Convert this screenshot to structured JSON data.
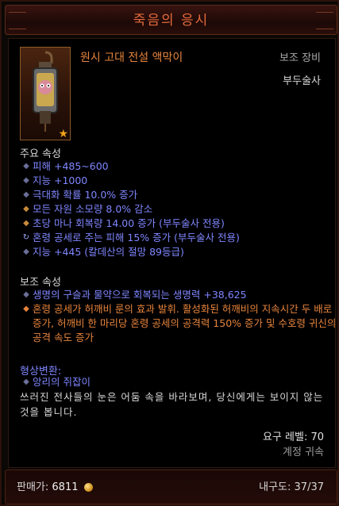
{
  "title": "죽음의 응시",
  "item": {
    "name": "원시 고대 전설 액막이",
    "type": "보조 장비",
    "class": "부두술사"
  },
  "primary": {
    "heading": "주요 속성",
    "stats": [
      {
        "text": "피해 +485~600",
        "color": "blue",
        "bullet": "diamond"
      },
      {
        "text": "지능 +1000",
        "color": "blue",
        "bullet": "diamond"
      },
      {
        "text": "극대화 확률 10.0% 증가",
        "color": "blue",
        "bullet": "diamond"
      },
      {
        "text": "모든 자원 소모량 8.0% 감소",
        "color": "blue",
        "bullet": "diamond-orange"
      },
      {
        "text": "초당 마나 회복량 14.00 증가 (부두술사 전용)",
        "color": "blue",
        "bullet": "diamond-orange"
      },
      {
        "text": "혼령 공세로 주는 피해 15% 증가 (부두술사 전용)",
        "color": "blue",
        "bullet": "reroll"
      },
      {
        "text": "지능 +445 (칼데산의 절망 89등급)",
        "color": "blue",
        "bullet": "diamond"
      }
    ]
  },
  "secondary": {
    "heading": "보조 속성",
    "stats": [
      {
        "text": "생명의 구슬과 물약으로 회복되는 생명력 +38,625",
        "color": "blue",
        "bullet": "diamond"
      }
    ],
    "legendary": "혼령 공세가 허깨비 룬의 효과 발휘. 활성화된 허깨비의 지속시간 두 배로 증가, 허깨비 한 마리당 혼령 공세의 공격력 150% 증가 및 수호령 귀신의 공격 속도 증가"
  },
  "transmog": {
    "heading": "형상변환:",
    "value": "앙리의 쥐잡이"
  },
  "flavor": "쓰러진 전사들의 눈은 어둠 속을 바라보며, 당신에게는 보이지 않는 것을 봅니다.",
  "requirements": {
    "level": "요구 레벨: 70",
    "bound": "계정 귀속"
  },
  "footer": {
    "sell_label": "판매가:",
    "sell_value": "6811",
    "durability_label": "내구도:",
    "durability_value": "37/37"
  },
  "colors": {
    "title": "#e56a3a",
    "legendary": "#e7843c",
    "magic": "#7f86ff"
  },
  "icons": {
    "item": "lantern-mojo-icon",
    "ancient_star": "star-icon",
    "gold": "gold-coin-icon"
  }
}
